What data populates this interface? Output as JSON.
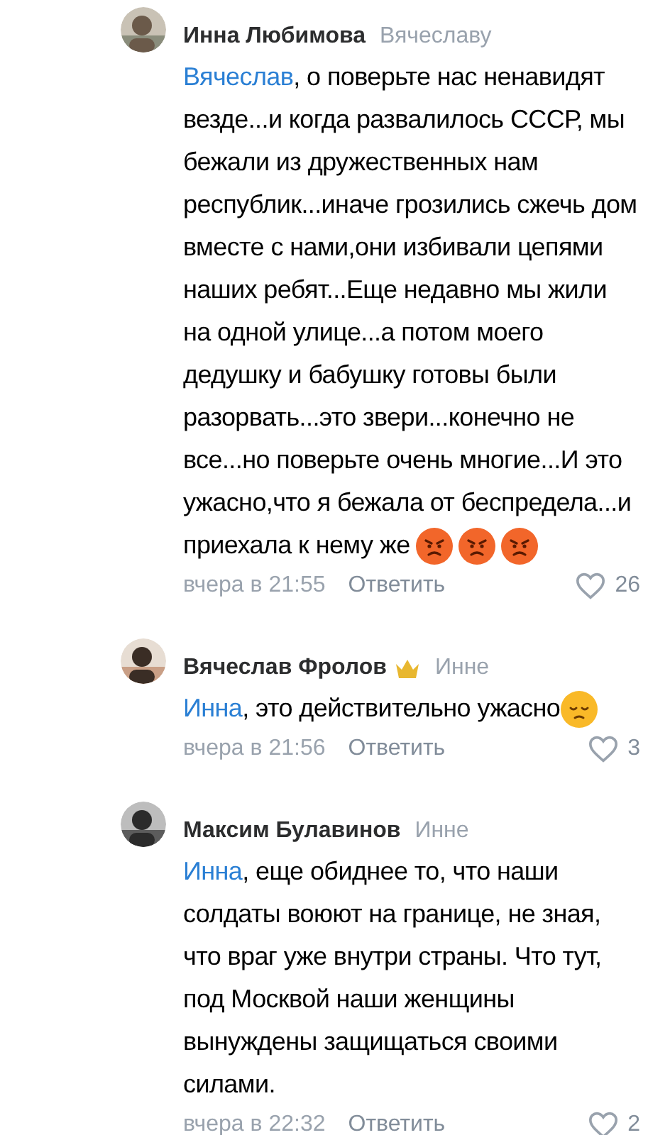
{
  "comments": [
    {
      "author": "Инна Любимова",
      "crown": false,
      "reply_to": "Вячеславу",
      "mention": "Вячеслав",
      "text": ", о поверьте нас ненавидят везде...и когда развалилось СССР, мы бежали из дружественных нам республик...иначе грозились сжечь дом вместе с нами,они избивали цепями наших ребят...Еще недавно мы жили на одной улице...а потом моего дедушку и бабушку готовы были разорвать...это звери...конечно не все...но поверьте очень многие...И это ужасно,что я бежала от беспредела...и приехала к нему же",
      "emojis": [
        {
          "kind": "angry"
        },
        {
          "kind": "angry"
        },
        {
          "kind": "angry"
        }
      ],
      "time": "вчера в 21:55",
      "reply_label": "Ответить",
      "likes": "26"
    },
    {
      "author": "Вячеслав Фролов",
      "crown": true,
      "reply_to": "Инне",
      "mention": "Инна",
      "text": ", это действительно ужасно",
      "emojis": [
        {
          "kind": "sad"
        }
      ],
      "time": "вчера в 21:56",
      "reply_label": "Ответить",
      "likes": "3"
    },
    {
      "author": "Максим Булавинов",
      "crown": false,
      "reply_to": "Инне",
      "mention": "Инна",
      "text": ", еще обиднее то, что наши солдаты воюют на границе, не зная, что враг уже внутри страны. Что тут, под Москвой наши женщины вынуждены защищаться своими силами.",
      "time": "вчера в 22:32",
      "reply_label": "Ответить",
      "likes": "2"
    }
  ]
}
